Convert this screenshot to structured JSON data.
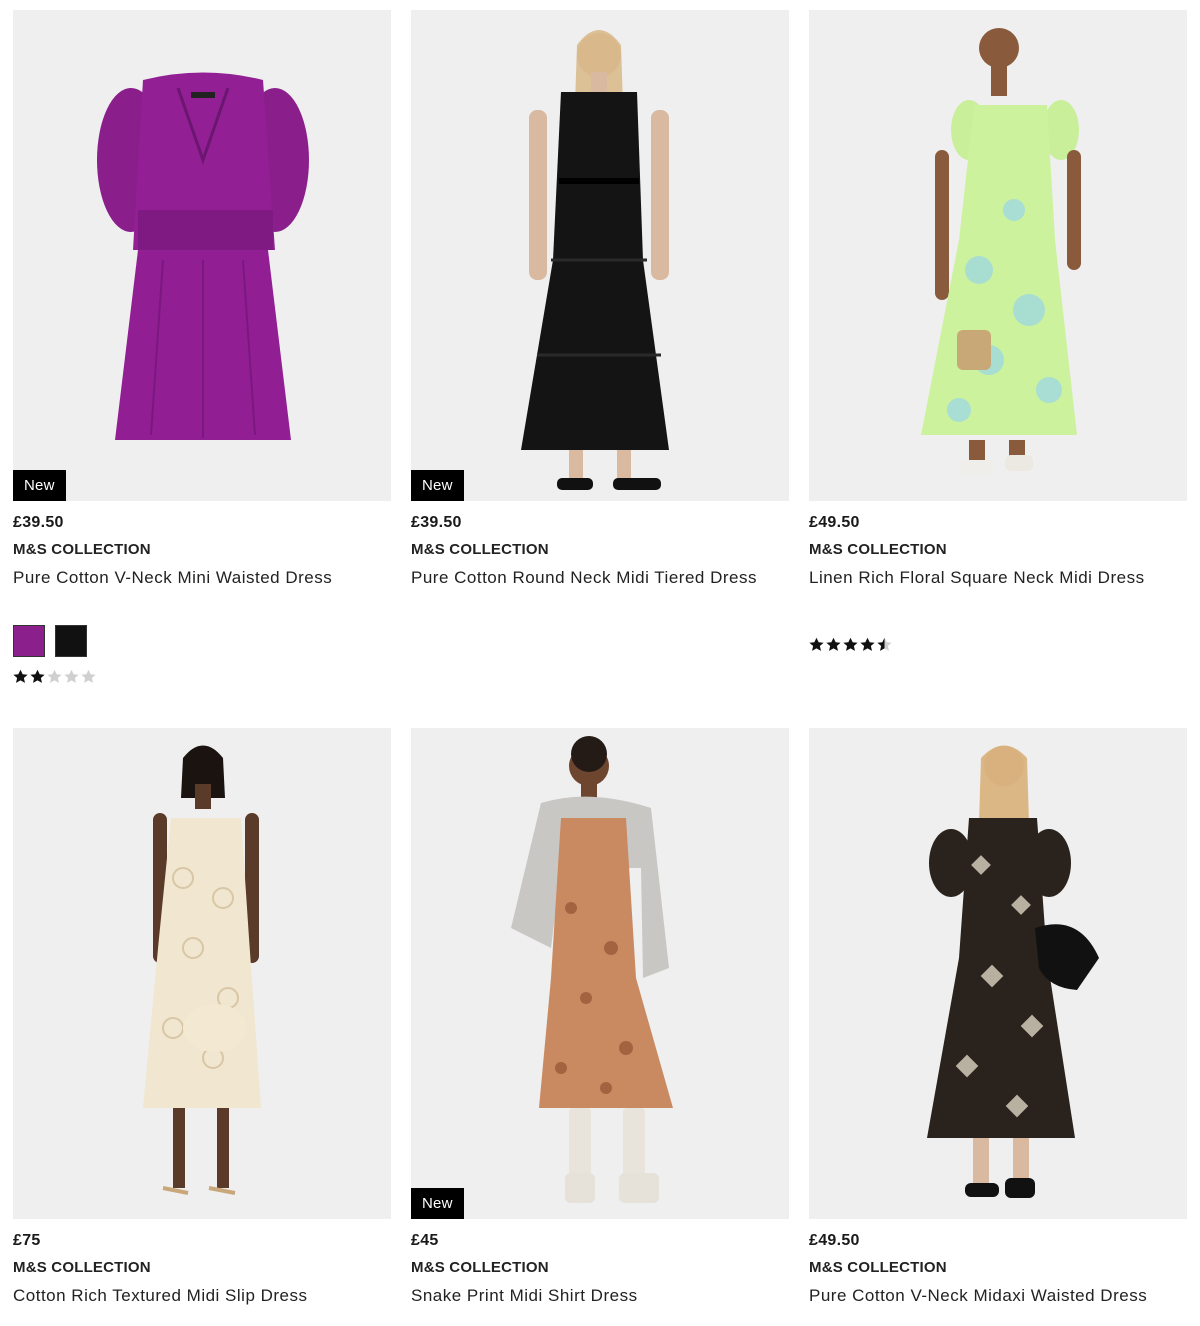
{
  "colors": {
    "badge_bg": "#000000",
    "star_filled": "#111111",
    "star_empty": "#d0d0d0"
  },
  "products": [
    {
      "price": "£39.50",
      "brand": "M&S COLLECTION",
      "name": "Pure Cotton V-Neck Mini Waisted Dress",
      "badge": "New",
      "image": "purple-dress-image",
      "swatches": [
        "#8b1f8c",
        "#111111"
      ],
      "rating": 2
    },
    {
      "price": "£39.50",
      "brand": "M&S COLLECTION",
      "name": "Pure Cotton Round Neck Midi Tiered Dress",
      "badge": "New",
      "image": "black-tiered-dress-image"
    },
    {
      "price": "£49.50",
      "brand": "M&S COLLECTION",
      "name": "Linen Rich Floral Square Neck Midi Dress",
      "image": "green-floral-dress-image",
      "rating": 4.5
    },
    {
      "price": "£75",
      "brand": "M&S COLLECTION",
      "name": "Cotton Rich Textured Midi Slip Dress",
      "image": "cream-slip-dress-image"
    },
    {
      "price": "£45",
      "brand": "M&S COLLECTION",
      "name": "Snake Print Midi Shirt Dress",
      "badge": "New",
      "image": "snake-print-dress-image"
    },
    {
      "price": "£49.50",
      "brand": "M&S COLLECTION",
      "name": "Pure Cotton V-Neck Midaxi Waisted Dress",
      "image": "black-print-midaxi-dress-image"
    }
  ]
}
